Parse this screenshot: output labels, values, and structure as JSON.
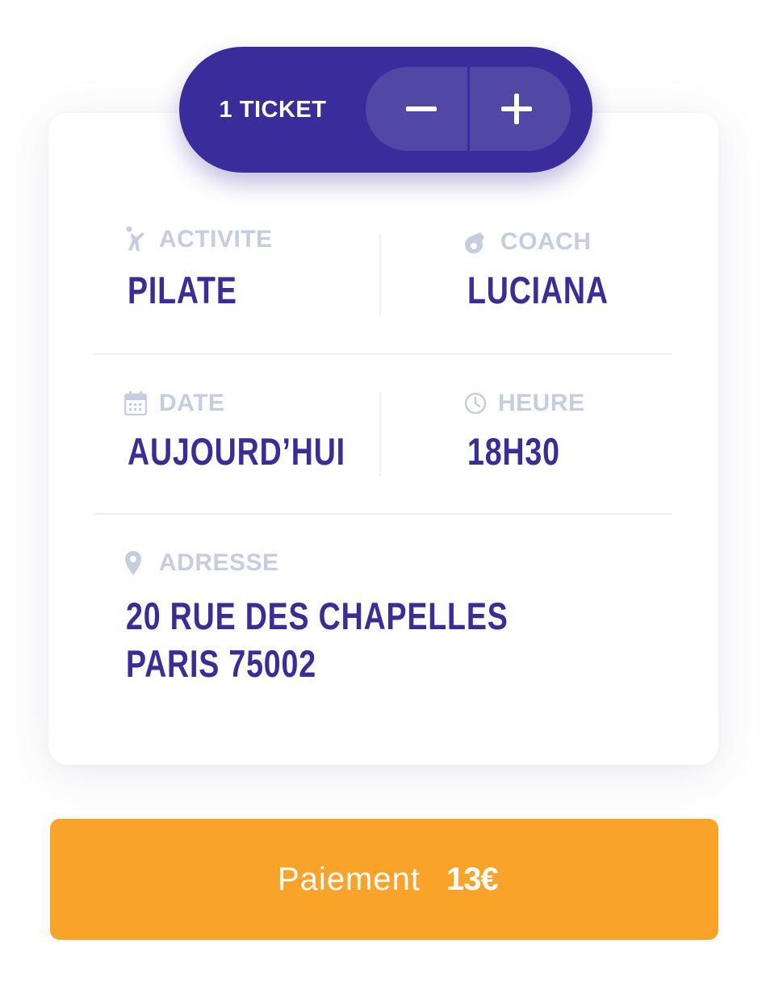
{
  "ticket": {
    "count_label": "1 TICKET",
    "decrement_icon": "minus-icon",
    "increment_icon": "plus-icon"
  },
  "details": {
    "activity": {
      "label": "ACTIVITE",
      "value": "PILATE",
      "icon": "activity-icon"
    },
    "coach": {
      "label": "COACH",
      "value": "LUCIANA",
      "icon": "whistle-icon"
    },
    "date": {
      "label": "DATE",
      "value": "AUJOURD’HUI",
      "icon": "calendar-icon"
    },
    "time": {
      "label": "HEURE",
      "value": "18H30",
      "icon": "clock-icon"
    },
    "address": {
      "label": "ADRESSE",
      "line1": "20 RUE DES CHAPELLES",
      "line2": "PARIS 75002",
      "icon": "location-pin-icon"
    }
  },
  "payment": {
    "label": "Paiement",
    "price": "13€"
  },
  "colors": {
    "primary": "#3a2c9a",
    "primary_light": "#5147a5",
    "muted": "#c6cde0",
    "accent": "#f9a328"
  }
}
